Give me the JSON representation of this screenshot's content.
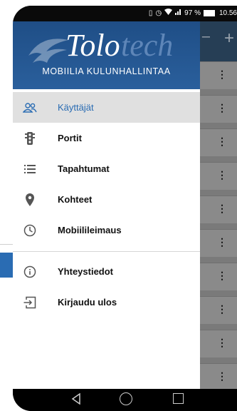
{
  "status_bar": {
    "battery": "97 %",
    "time": "10.56",
    "icons": [
      "vibrate-icon",
      "alarm-icon",
      "wifi-icon",
      "signal-icon",
      "battery-icon"
    ]
  },
  "drawer": {
    "logo_main": "Tolo",
    "logo_suffix": "tech",
    "tagline": "MOBIILIA KULUNHALLINTAA",
    "items": [
      {
        "label": "Käyttäjät",
        "icon": "users-icon",
        "active": true
      },
      {
        "label": "Portit",
        "icon": "traffic-light-icon",
        "active": false
      },
      {
        "label": "Tapahtumat",
        "icon": "list-icon",
        "active": false
      },
      {
        "label": "Kohteet",
        "icon": "location-pin-icon",
        "active": false
      },
      {
        "label": "Mobiilileimaus",
        "icon": "clock-icon",
        "active": false
      },
      {
        "label": "Yhteystiedot",
        "icon": "info-icon",
        "active": false
      },
      {
        "label": "Kirjaudu ulos",
        "icon": "logout-icon",
        "active": false
      }
    ]
  },
  "appbar": {
    "add_label": "+"
  },
  "colors": {
    "header_blue": "#1f4e86",
    "active_text": "#2a6cb3",
    "appbar": "#263e55"
  }
}
